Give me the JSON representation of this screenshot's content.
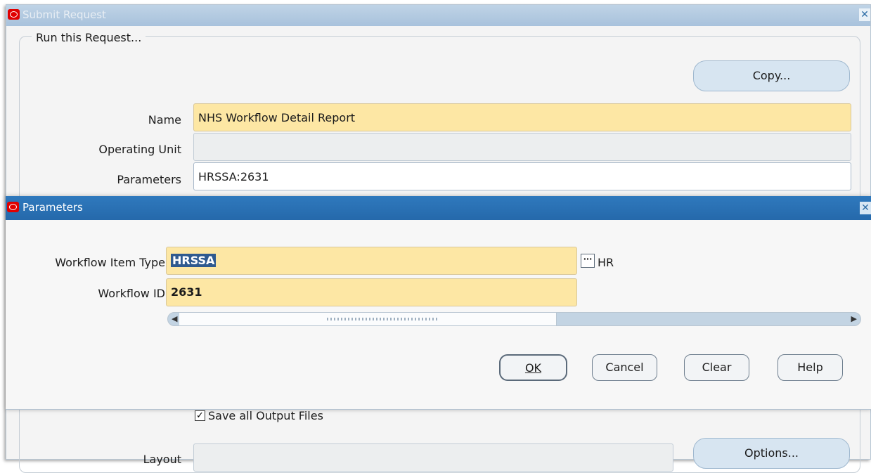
{
  "outer": {
    "title": "Submit Request",
    "group_label": "Run this Request...",
    "copy_button": "Copy...",
    "name_label": "Name",
    "name_value": "NHS Workflow Detail Report",
    "operating_unit_label": "Operating Unit",
    "operating_unit_value": "",
    "parameters_label": "Parameters",
    "parameters_value": "HRSSA:2631",
    "save_output_label": "Save all Output Files",
    "save_output_checked": true,
    "layout_label": "Layout",
    "options_button": "Options..."
  },
  "params": {
    "title": "Parameters",
    "item_type_label": "Workflow Item Type",
    "item_type_value": "HRSSA",
    "item_type_desc": "HR",
    "workflow_id_label": "Workflow ID",
    "workflow_id_value": "2631",
    "buttons": {
      "ok": "OK",
      "cancel": "Cancel",
      "clear": "Clear",
      "help": "Help"
    }
  },
  "colors": {
    "required_field": "#fde7a4",
    "titlebar_active": "#2f79bd",
    "titlebar_inactive": "#a8c2dc"
  }
}
